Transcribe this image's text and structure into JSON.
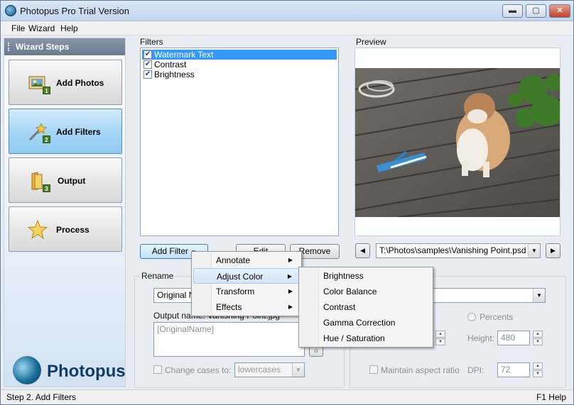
{
  "window": {
    "title": "Photopus Pro Trial Version",
    "controls": {
      "minimize": "▬",
      "maximize": "▢",
      "close": "✕"
    }
  },
  "menubar": {
    "items": [
      "File",
      "Wizard",
      "Help"
    ]
  },
  "sidebar": {
    "header": "Wizard Steps",
    "steps": [
      {
        "label": "Add Photos",
        "badge": "1",
        "icon": "photo-icon"
      },
      {
        "label": "Add Filters",
        "badge": "2",
        "icon": "magic-wand-icon"
      },
      {
        "label": "Output",
        "badge": "3",
        "icon": "folder-icon"
      },
      {
        "label": "Process",
        "badge": "",
        "icon": "star-icon"
      }
    ],
    "logo": "Photopus"
  },
  "filters": {
    "label": "Filters",
    "items": [
      {
        "label": "Watermark Text",
        "checked": true,
        "selected": true
      },
      {
        "label": "Contrast",
        "checked": true,
        "selected": false
      },
      {
        "label": "Brightness",
        "checked": true,
        "selected": false
      }
    ],
    "buttons": {
      "add": "Add Filter",
      "edit": "Edit",
      "remove": "Remove"
    }
  },
  "preview": {
    "label": "Preview",
    "path": "T:\\Photos\\samples\\Vanishing Point.psd"
  },
  "rename": {
    "label": "Rename",
    "template_value": "Original Na",
    "output_name_label": "Output name: Vanishing Point.jpg",
    "output_name_value": "[OriginalName]",
    "change_cases_label": "Change cases to:",
    "case_value": "lowercases"
  },
  "resize": {
    "percents_label": "Percents",
    "height_label": "Height:",
    "height_value": "480",
    "aspect_label": "Maintain aspect ratio",
    "dpi_label": "DPI:",
    "dpi_value": "72"
  },
  "context_menu": {
    "items": [
      "Annotate",
      "Adjust Color",
      "Transform",
      "Effects"
    ],
    "highlighted": "Adjust Color",
    "submenu": [
      "Brightness",
      "Color Balance",
      "Contrast",
      "Gamma Correction",
      "Hue / Saturation"
    ]
  },
  "statusbar": {
    "left": "Step 2. Add Filters",
    "right": "F1 Help"
  },
  "colors": {
    "accent": "#3399ff",
    "active_step": "#a7d7f6",
    "title_bar": "#c2d6ee"
  }
}
